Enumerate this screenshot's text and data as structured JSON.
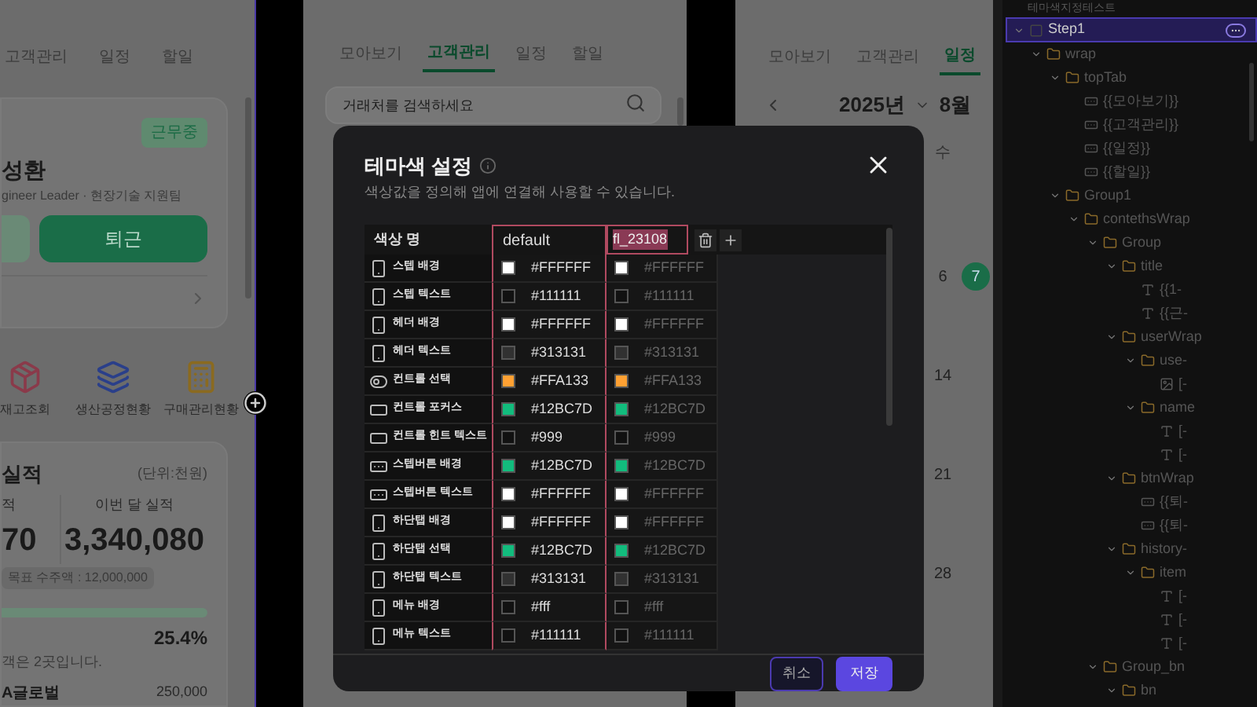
{
  "left_screen": {
    "tabs": [
      {
        "label": "고객관리",
        "selected": false
      },
      {
        "label": "일정",
        "selected": false
      },
      {
        "label": "할일",
        "selected": false
      }
    ],
    "status_badge": "근무중",
    "user_name": "성환",
    "user_role": "gineer Leader · 현장기술 지원팀",
    "leave_button": "퇴근",
    "shortcuts": [
      {
        "label": "재고조회",
        "kind": "box"
      },
      {
        "label": "생산공정현황",
        "kind": "layers"
      },
      {
        "label": "구매관리현황",
        "kind": "calculator"
      }
    ],
    "performance": {
      "title": "실적",
      "unit": "(단위:천원)",
      "col_1_label": "적",
      "col_1_value": "70",
      "col_2_label": "이번 달 실적",
      "col_2_value": "3,340,080",
      "target": "목표 수주액 : 12,000,000",
      "percent": "25.4%",
      "note": "객은 2곳입니다.",
      "client": "A글로벌",
      "client_amount": "250,000"
    }
  },
  "middle_screen": {
    "tabs": [
      {
        "label": "모아보기",
        "selected": false
      },
      {
        "label": "고객관리",
        "selected": true
      },
      {
        "label": "일정",
        "selected": false
      },
      {
        "label": "할일",
        "selected": false
      }
    ],
    "search": {
      "placeholder": "거래처를 검색하세요"
    }
  },
  "right_screen": {
    "tabs": [
      {
        "label": "모아보기",
        "selected": false
      },
      {
        "label": "고객관리",
        "selected": false
      },
      {
        "label": "일정",
        "selected": true
      }
    ],
    "year": "2025년",
    "month": "8월",
    "weekday": "수",
    "weeks": [
      [
        {
          "label": "6",
          "selected": false
        },
        {
          "label": "7",
          "selected": true
        }
      ],
      [
        {
          "label": "14",
          "selected": false
        }
      ],
      [
        {
          "label": "21",
          "selected": false
        }
      ],
      [
        {
          "label": "28",
          "selected": false
        }
      ]
    ]
  },
  "theme_dialog": {
    "title": "테마색 설정",
    "subtitle": "색상값을 정의해 앱에 연결해 사용할 수 있습니다.",
    "columns": {
      "name": "색상 명",
      "default": "default",
      "theme_input": "fl_23108",
      "theme_input_text_selected": true
    },
    "rows": [
      {
        "name": "스텝 배경",
        "default": {
          "value": "#FFFFFF",
          "color": "#ffffff"
        },
        "theme": {
          "value": "#FFFFFF",
          "color": "#ffffff"
        }
      },
      {
        "name": "스텝 텍스트",
        "default": {
          "value": "#111111",
          "color": "#111111"
        },
        "theme": {
          "value": "#111111",
          "color": "#111111"
        }
      },
      {
        "name": "헤더 배경",
        "default": {
          "value": "#FFFFFF",
          "color": "#ffffff"
        },
        "theme": {
          "value": "#FFFFFF",
          "color": "#ffffff"
        }
      },
      {
        "name": "헤더 텍스트",
        "default": {
          "value": "#313131",
          "color": "#313131"
        },
        "theme": {
          "value": "#313131",
          "color": "#313131"
        }
      },
      {
        "name": "컨트롤 선택",
        "default": {
          "value": "#FFA133",
          "color": "#ffa133"
        },
        "theme": {
          "value": "#FFA133",
          "color": "#ffa133"
        }
      },
      {
        "name": "컨트롤 포커스",
        "default": {
          "value": "#12BC7D",
          "color": "#12bc7d"
        },
        "theme": {
          "value": "#12BC7D",
          "color": "#12bc7d"
        }
      },
      {
        "name": "컨트롤 힌트 텍스트",
        "default": {
          "value": "#999",
          "color": "#111111"
        },
        "theme": {
          "value": "#999",
          "color": "#111111"
        }
      },
      {
        "name": "스텝버튼 배경",
        "default": {
          "value": "#12BC7D",
          "color": "#12bc7d"
        },
        "theme": {
          "value": "#12BC7D",
          "color": "#12bc7d"
        }
      },
      {
        "name": "스텝버튼 텍스트",
        "default": {
          "value": "#FFFFFF",
          "color": "#ffffff"
        },
        "theme": {
          "value": "#FFFFFF",
          "color": "#ffffff"
        }
      },
      {
        "name": "하단탭 배경",
        "default": {
          "value": "#FFFFFF",
          "color": "#ffffff"
        },
        "theme": {
          "value": "#FFFFFF",
          "color": "#ffffff"
        }
      },
      {
        "name": "하단탭 선택",
        "default": {
          "value": "#12BC7D",
          "color": "#12bc7d"
        },
        "theme": {
          "value": "#12BC7D",
          "color": "#12bc7d"
        }
      },
      {
        "name": "하단탭 텍스트",
        "default": {
          "value": "#313131",
          "color": "#313131"
        },
        "theme": {
          "value": "#313131",
          "color": "#313131"
        }
      },
      {
        "name": "메뉴 배경",
        "default": {
          "value": "#fff",
          "color": "#111111"
        },
        "theme": {
          "value": "#fff",
          "color": "#111111"
        }
      },
      {
        "name": "메뉴 텍스트",
        "default": {
          "value": "#111111",
          "color": "#111111"
        },
        "theme": {
          "value": "#111111",
          "color": "#111111"
        }
      }
    ],
    "buttons": [
      {
        "label": "취소",
        "kind": "secondary"
      },
      {
        "label": "저장",
        "kind": "primary"
      }
    ]
  },
  "tree_panel": {
    "title": "테마색지정테스트",
    "nodes": [
      {
        "label": "Step1",
        "kind": "step",
        "selected": true,
        "expanded": true,
        "children": [
          {
            "label": "wrap",
            "kind": "folder",
            "selected": false,
            "expanded": true,
            "children": [
              {
                "label": "topTab",
                "kind": "folder",
                "selected": false,
                "expanded": true,
                "children": [
                  {
                    "label": "{{모아보기}}",
                    "kind": "button",
                    "selected": false
                  },
                  {
                    "label": "{{고객관리}}",
                    "kind": "button",
                    "selected": false
                  },
                  {
                    "label": "{{일정}}",
                    "kind": "button",
                    "selected": false
                  },
                  {
                    "label": "{{할일}}",
                    "kind": "button",
                    "selected": false
                  }
                ]
              },
              {
                "label": "Group1",
                "kind": "folder",
                "selected": false,
                "expanded": true,
                "children": [
                  {
                    "label": "contethsWrap",
                    "kind": "folder",
                    "selected": false,
                    "expanded": true,
                    "children": [
                      {
                        "label": "Group",
                        "kind": "folder",
                        "selected": false,
                        "expanded": true,
                        "children": [
                          {
                            "label": "title",
                            "kind": "folder",
                            "selected": false,
                            "expanded": true,
                            "children": [
                              {
                                "label": "{{1-",
                                "kind": "text",
                                "selected": false
                              },
                              {
                                "label": "{{근-",
                                "kind": "text",
                                "selected": false
                              }
                            ]
                          },
                          {
                            "label": "userWrap",
                            "kind": "folder",
                            "selected": false,
                            "expanded": true,
                            "children": [
                              {
                                "label": "use-",
                                "kind": "folder",
                                "selected": false,
                                "expanded": true,
                                "children": [
                                  {
                                    "label": "[-",
                                    "kind": "image",
                                    "selected": false
                                  }
                                ]
                              },
                              {
                                "label": "name",
                                "kind": "folder",
                                "selected": false,
                                "expanded": true,
                                "children": [
                                  {
                                    "label": "[-",
                                    "kind": "text",
                                    "selected": false
                                  },
                                  {
                                    "label": "[-",
                                    "kind": "text",
                                    "selected": false
                                  }
                                ]
                              }
                            ]
                          },
                          {
                            "label": "btnWrap",
                            "kind": "folder",
                            "selected": false,
                            "expanded": true,
                            "children": [
                              {
                                "label": "{{퇴-",
                                "kind": "button",
                                "selected": false
                              },
                              {
                                "label": "{{퇴-",
                                "kind": "button",
                                "selected": false
                              }
                            ]
                          },
                          {
                            "label": "history-",
                            "kind": "folder",
                            "selected": false,
                            "expanded": true,
                            "children": [
                              {
                                "label": "item",
                                "kind": "folder",
                                "selected": false,
                                "expanded": true,
                                "children": [
                                  {
                                    "label": "[-",
                                    "kind": "text",
                                    "selected": false
                                  },
                                  {
                                    "label": "[-",
                                    "kind": "text",
                                    "selected": false
                                  },
                                  {
                                    "label": "[-",
                                    "kind": "text",
                                    "selected": false
                                  }
                                ]
                              }
                            ]
                          }
                        ]
                      },
                      {
                        "label": "Group_bn",
                        "kind": "folder",
                        "selected": false,
                        "expanded": true,
                        "children": [
                          {
                            "label": "bn",
                            "kind": "folder",
                            "selected": false,
                            "expanded": true
                          }
                        ]
                      }
                    ]
                  }
                ]
              }
            ]
          }
        ]
      }
    ]
  }
}
